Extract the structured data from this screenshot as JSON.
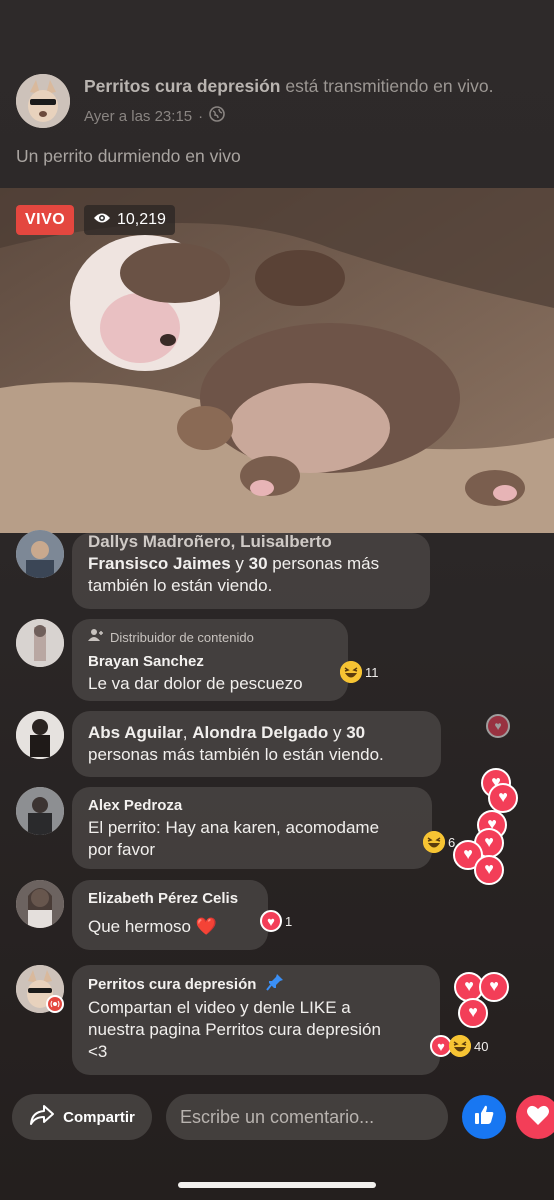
{
  "header": {
    "page_name": "Perritos cura depresión",
    "status_text": " está transmitiendo en vivo.",
    "timestamp": "Ayer a las 23:15",
    "separator": "·",
    "privacy_icon": "globe-icon",
    "caption": "Un perrito durmiendo en vivo"
  },
  "video": {
    "live_label": "VIVO",
    "viewer_count": "10,219",
    "live_color": "#e4473f"
  },
  "comments": [
    {
      "names_line": "Dallys Madroñero, Luisalberto",
      "name_bold": "Fransisco Jaimes",
      "text_y": " y ",
      "count": "30",
      "text_rest1": " personas más",
      "text_rest2": "también lo están viendo."
    },
    {
      "badge": "Distribuidor de contenido",
      "name": "Brayan Sanchez",
      "text": "Le va dar dolor de pescuezo",
      "reaction_count": "11"
    },
    {
      "name_a": "Abs Aguilar",
      "comma": ", ",
      "name_b": "Alondra Delgado",
      "text_y": " y ",
      "count": "30",
      "line2": "personas más también lo están viendo."
    },
    {
      "name": "Alex Pedroza",
      "line1": "El perrito: Hay ana karen, acomodame",
      "line2": "por favor",
      "reaction_count": "6"
    },
    {
      "name": "Elizabeth Pérez Celis",
      "text": "Que hermoso ",
      "emoji": "❤️",
      "reaction_count": "1"
    },
    {
      "name": "Perritos cura depresión",
      "line1": "Compartan el video y denle LIKE a",
      "line2": "nuestra pagina Perritos cura depresión",
      "line3": "<3",
      "reaction_count": "40"
    }
  ],
  "bottom": {
    "share_label": "Compartir",
    "comment_placeholder": "Escribe un comentario..."
  },
  "colors": {
    "like": "#1877f2",
    "love": "#f33e58",
    "haha": "#f7c433"
  }
}
